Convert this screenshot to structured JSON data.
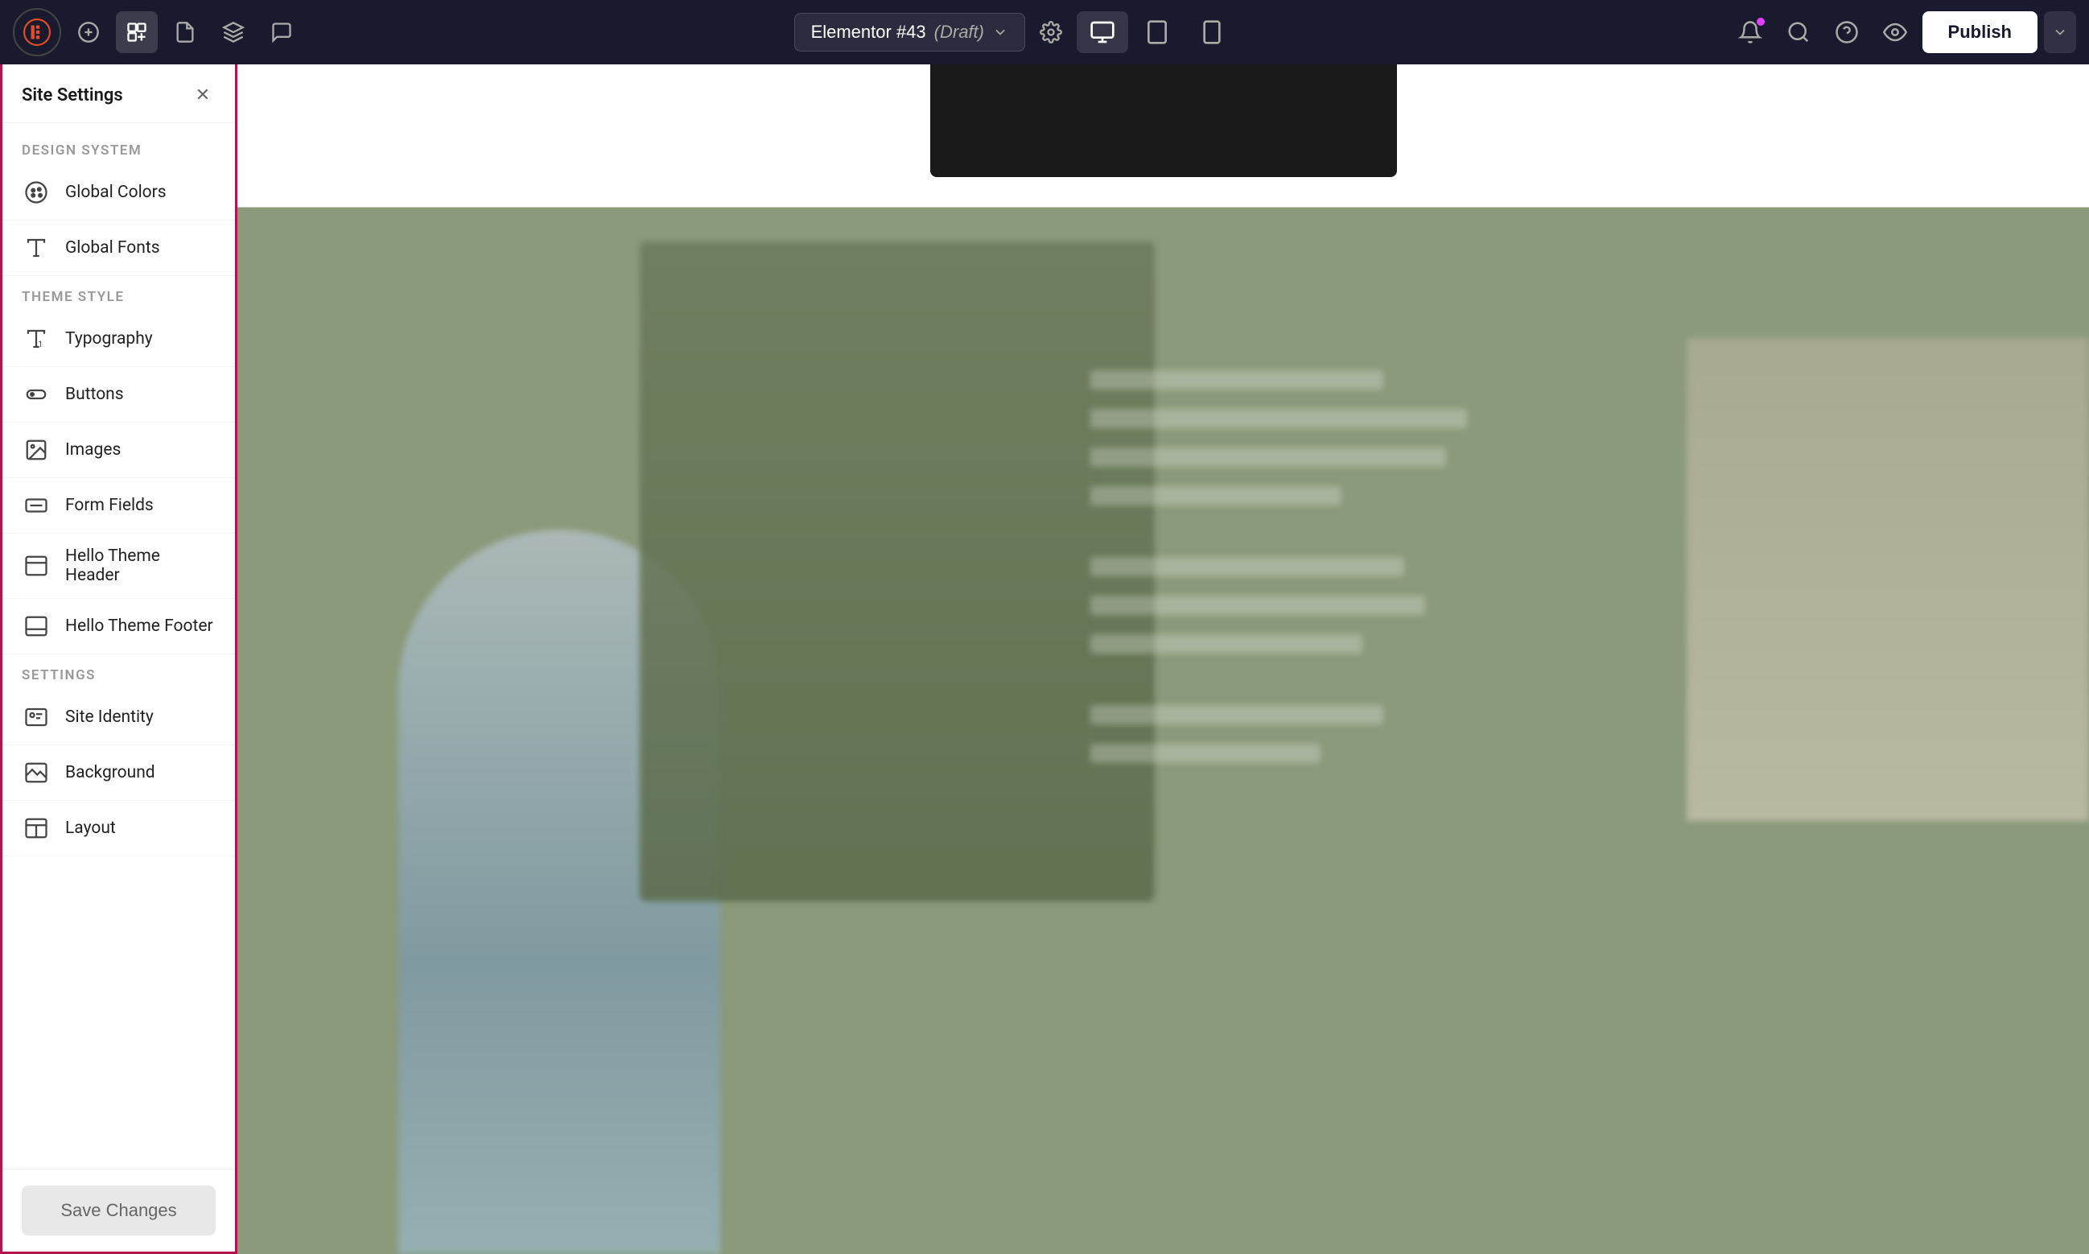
{
  "toolbar": {
    "logo_label": "Elementor",
    "page_title": "Elementor #43",
    "draft_label": "(Draft)",
    "settings_icon": "gear-icon",
    "publish_label": "Publish",
    "views": [
      {
        "id": "desktop",
        "label": "Desktop"
      },
      {
        "id": "tablet",
        "label": "Tablet"
      },
      {
        "id": "mobile",
        "label": "Mobile"
      }
    ]
  },
  "sidebar": {
    "title": "Site Settings",
    "close_icon": "close-icon",
    "sections": [
      {
        "id": "design_system",
        "label": "DESIGN SYSTEM",
        "items": [
          {
            "id": "global_colors",
            "label": "Global Colors",
            "icon": "palette-icon"
          },
          {
            "id": "global_fonts",
            "label": "Global Fonts",
            "icon": "font-icon"
          }
        ]
      },
      {
        "id": "theme_style",
        "label": "THEME STYLE",
        "items": [
          {
            "id": "typography",
            "label": "Typography",
            "icon": "typography-icon"
          },
          {
            "id": "buttons",
            "label": "Buttons",
            "icon": "button-icon"
          },
          {
            "id": "images",
            "label": "Images",
            "icon": "image-icon"
          },
          {
            "id": "form_fields",
            "label": "Form Fields",
            "icon": "form-icon"
          },
          {
            "id": "hello_theme_header",
            "label": "Hello Theme Header",
            "icon": "header-icon"
          },
          {
            "id": "hello_theme_footer",
            "label": "Hello Theme Footer",
            "icon": "footer-icon"
          }
        ]
      },
      {
        "id": "settings",
        "label": "SETTINGS",
        "items": [
          {
            "id": "site_identity",
            "label": "Site Identity",
            "icon": "identity-icon"
          },
          {
            "id": "background",
            "label": "Background",
            "icon": "background-icon"
          },
          {
            "id": "layout",
            "label": "Layout",
            "icon": "layout-icon"
          }
        ]
      }
    ],
    "save_changes_label": "Save Changes"
  },
  "accent_color": "#b5144a",
  "brand_color": "#1a1a2e"
}
